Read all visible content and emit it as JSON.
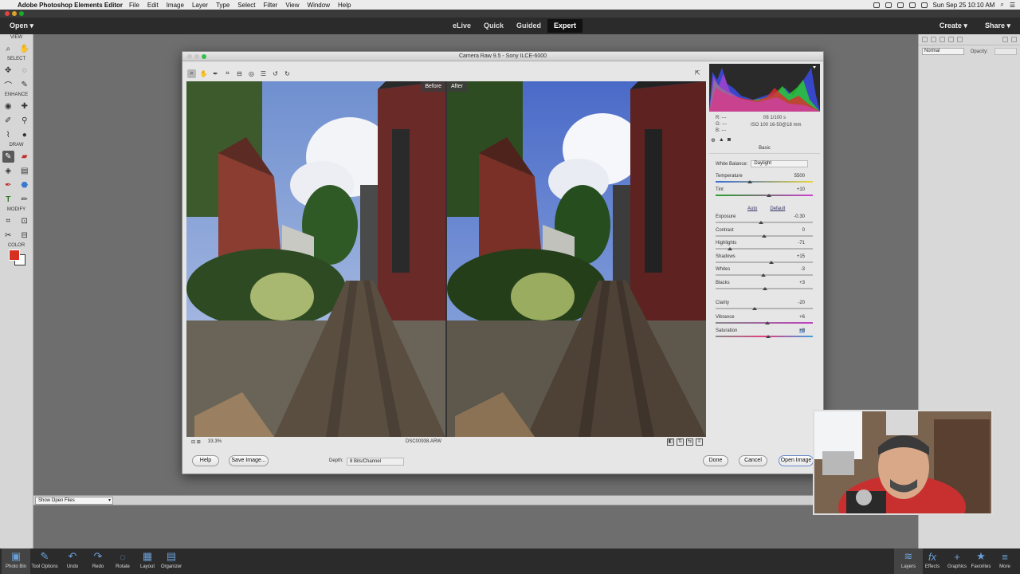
{
  "menubar": {
    "app_name": "Adobe Photoshop Elements Editor",
    "items": [
      "File",
      "Edit",
      "Image",
      "Layer",
      "Type",
      "Select",
      "Filter",
      "View",
      "Window",
      "Help"
    ],
    "clock": "Sun Sep 25  10:10 AM"
  },
  "header": {
    "open_label": "Open ▾",
    "modes": [
      {
        "label": "eLive",
        "active": false
      },
      {
        "label": "Quick",
        "active": false
      },
      {
        "label": "Guided",
        "active": false
      },
      {
        "label": "Expert",
        "active": true
      }
    ],
    "create_label": "Create ▾",
    "share_label": "Share ▾"
  },
  "toolbox": {
    "sections": [
      "VIEW",
      "SELECT",
      "ENHANCE",
      "DRAW",
      "MODIFY",
      "COLOR"
    ],
    "foreground_color": "#d83020",
    "background_color": "#ffffff"
  },
  "right_panel": {
    "blend_mode": "Normal",
    "opacity_label": "Opacity:"
  },
  "open_files": {
    "label": "Show Open Files"
  },
  "bottom_bar": {
    "left_items": [
      {
        "label": "Photo Bin",
        "icon": "photo-bin-icon",
        "glyph": "▣"
      },
      {
        "label": "Tool Options",
        "icon": "tool-options-icon",
        "glyph": "✎"
      },
      {
        "label": "Undo",
        "icon": "undo-icon",
        "glyph": "↶"
      },
      {
        "label": "Redo",
        "icon": "redo-icon",
        "glyph": "↷"
      },
      {
        "label": "Rotate",
        "icon": "rotate-icon",
        "glyph": "◌"
      },
      {
        "label": "Layout",
        "icon": "layout-icon",
        "glyph": "▦"
      },
      {
        "label": "Organizer",
        "icon": "organizer-icon",
        "glyph": "▤"
      }
    ],
    "right_items": [
      {
        "label": "Layers",
        "icon": "layers-icon",
        "glyph": "≋"
      },
      {
        "label": "Effects",
        "icon": "effects-icon",
        "glyph": "fx"
      },
      {
        "label": "Graphics",
        "icon": "graphics-icon",
        "glyph": "+"
      },
      {
        "label": "Favorites",
        "icon": "favorites-icon",
        "glyph": "★"
      },
      {
        "label": "More",
        "icon": "more-icon",
        "glyph": "≡"
      }
    ]
  },
  "camera_raw": {
    "title": "Camera Raw 9.5  -  Sony ILCE-6000",
    "before_label": "Before",
    "after_label": "After",
    "zoom": "33.3%",
    "filename": "DSC00938.ARW",
    "readout": {
      "r": "R:   ---",
      "g": "G:   ---",
      "b": "B:   ---",
      "aperture_shutter": "f/8    1/100 s",
      "iso_lens": "ISO 100   16-50@18 mm"
    },
    "panel_title": "Basic",
    "white_balance_label": "White Balance:",
    "white_balance_value": "Daylight",
    "auto_label": "Auto",
    "default_label": "Default",
    "sliders": [
      {
        "name": "Temperature",
        "value": "5500",
        "position": 0.35,
        "gradient": "linear-gradient(90deg,#3a6ad8,#e6d640)"
      },
      {
        "name": "Tint",
        "value": "+10",
        "position": 0.55,
        "gradient": "linear-gradient(90deg,#2ca02c,#d040d0)"
      },
      {
        "name": "Exposure",
        "value": "-0.30",
        "position": 0.47,
        "gradient": ""
      },
      {
        "name": "Contrast",
        "value": "0",
        "position": 0.5,
        "gradient": ""
      },
      {
        "name": "Highlights",
        "value": "-71",
        "position": 0.15,
        "gradient": ""
      },
      {
        "name": "Shadows",
        "value": "+15",
        "position": 0.57,
        "gradient": ""
      },
      {
        "name": "Whites",
        "value": "-3",
        "position": 0.49,
        "gradient": ""
      },
      {
        "name": "Blacks",
        "value": "+3",
        "position": 0.51,
        "gradient": ""
      },
      {
        "name": "Clarity",
        "value": "-20",
        "position": 0.4,
        "gradient": ""
      },
      {
        "name": "Vibrance",
        "value": "+6",
        "position": 0.53,
        "gradient": "linear-gradient(90deg,#888,#c040c0)"
      },
      {
        "name": "Saturation",
        "value": "+8",
        "position": 0.54,
        "gradient": "linear-gradient(90deg,#888,#e04080,#40a0e0)"
      }
    ],
    "buttons": {
      "help": "Help",
      "save_image": "Save Image...",
      "depth_label": "Depth:",
      "depth_value": "8 Bits/Channel",
      "done": "Done",
      "cancel": "Cancel",
      "open_image": "Open Image"
    }
  }
}
